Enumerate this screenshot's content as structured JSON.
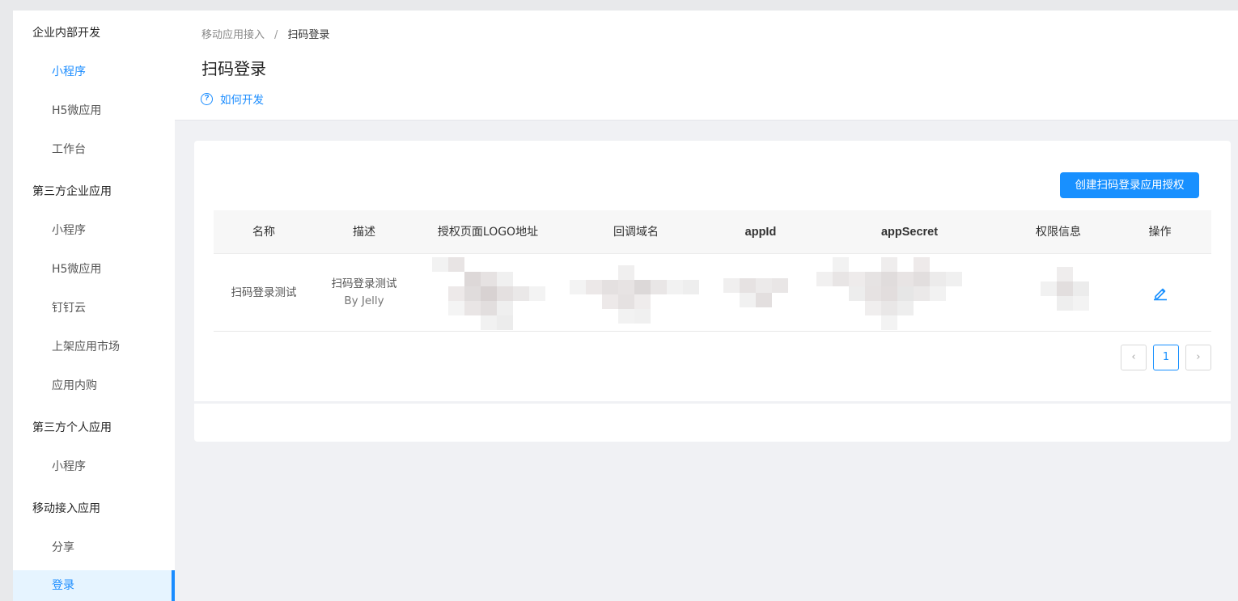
{
  "sidebar": {
    "groups": [
      {
        "label": "企业内部开发",
        "items": [
          "小程序",
          "H5微应用",
          "工作台"
        ]
      },
      {
        "label": "第三方企业应用",
        "items": [
          "小程序",
          "H5微应用",
          "钉钉云",
          "上架应用市场",
          "应用内购"
        ]
      },
      {
        "label": "第三方个人应用",
        "items": [
          "小程序"
        ]
      },
      {
        "label": "移动接入应用",
        "items": [
          "分享",
          "登录"
        ]
      }
    ]
  },
  "header": {
    "breadcrumb": [
      "移动应用接入",
      "扫码登录"
    ],
    "separator": "/",
    "title": "扫码登录",
    "howto_label": "如何开发",
    "howto_icon": "?"
  },
  "card": {
    "create_button": "创建扫码登录应用授权",
    "columns": [
      "名称",
      "描述",
      "授权页面LOGO地址",
      "回调域名",
      "appId",
      "appSecret",
      "权限信息",
      "操作"
    ],
    "rows": [
      {
        "name": "扫码登录测试",
        "description": "扫码登录测试",
        "description_sub": "By Jelly"
      }
    ],
    "pagination": {
      "prev": "‹",
      "current": "1",
      "next": "›"
    }
  },
  "colors": {
    "accent": "#1890ff",
    "sidebar_selected_bg": "#e6f4ff"
  }
}
